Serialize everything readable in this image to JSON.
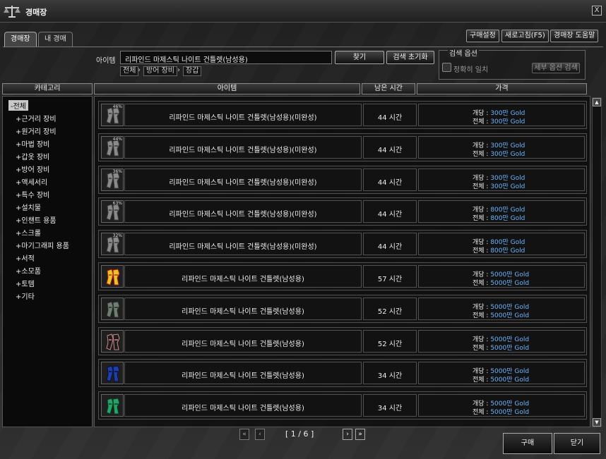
{
  "window": {
    "title": "경매장",
    "close_label": "X"
  },
  "tabs": [
    {
      "label": "경매장"
    },
    {
      "label": "내 경매"
    }
  ],
  "top_buttons": {
    "purchase_settings": "구매설정",
    "refresh": "새로고침(F5)",
    "help": "경매장 도움말"
  },
  "search": {
    "item_label": "아이템",
    "query": "리파인드 마제스틱 나이트 건틀렛(남성용)",
    "find_label": "찾기",
    "reset_label": "검색 초기화",
    "breadcrumb": [
      "전체",
      "방어 장비",
      "장갑"
    ]
  },
  "options": {
    "title": "검색 옵션",
    "exact_match": "정확히 일치",
    "exact_checked": false,
    "detail_label": "세부 옵션 검색"
  },
  "headers": {
    "category": "카테고리",
    "item": "아이템",
    "time_left": "남은 시간",
    "price": "가격"
  },
  "categories": [
    {
      "label": "-전체",
      "selected": true
    },
    {
      "label": "+근거리 장비"
    },
    {
      "label": "+원거리 장비"
    },
    {
      "label": "+마법 장비"
    },
    {
      "label": "+갑옷 장비"
    },
    {
      "label": "+방어 장비"
    },
    {
      "label": "+액세서리"
    },
    {
      "label": "+특수 장비"
    },
    {
      "label": "+설치물"
    },
    {
      "label": "+인챈트 용품"
    },
    {
      "label": "+스크롤"
    },
    {
      "label": "+마기그래피 용품"
    },
    {
      "label": "+서적"
    },
    {
      "label": "+소모품"
    },
    {
      "label": "+토템"
    },
    {
      "label": "+기타"
    }
  ],
  "items": [
    {
      "pct": "46%",
      "name": "리파인드 마제스틱 나이트 건틀렛(남성용)(미완성)",
      "time": "44 시간",
      "unit_label": "개당 : ",
      "unit_price": "300만 Gold",
      "total_label": "전체 : ",
      "total_price": "300만 Gold",
      "color": "#8a8a8a",
      "accent": "#3a3a3a"
    },
    {
      "pct": "44%",
      "name": "리파인드 마제스틱 나이트 건틀렛(남성용)(미완성)",
      "time": "44 시간",
      "unit_label": "개당 : ",
      "unit_price": "300만 Gold",
      "total_label": "전체 : ",
      "total_price": "300만 Gold",
      "color": "#8a8a8a",
      "accent": "#3a3a3a"
    },
    {
      "pct": "36%",
      "name": "리파인드 마제스틱 나이트 건틀렛(남성용)(미완성)",
      "time": "44 시간",
      "unit_label": "개당 : ",
      "unit_price": "300만 Gold",
      "total_label": "전체 : ",
      "total_price": "300만 Gold",
      "color": "#8a8a8a",
      "accent": "#3a3a3a"
    },
    {
      "pct": "63%",
      "name": "리파인드 마제스틱 나이트 건틀렛(남성용)(미완성)",
      "time": "44 시간",
      "unit_label": "개당 : ",
      "unit_price": "800만 Gold",
      "total_label": "전체 : ",
      "total_price": "800만 Gold",
      "color": "#8a8a8a",
      "accent": "#3a3a3a"
    },
    {
      "pct": "32%",
      "name": "리파인드 마제스틱 나이트 건틀렛(남성용)(미완성)",
      "time": "44 시간",
      "unit_label": "개당 : ",
      "unit_price": "800만 Gold",
      "total_label": "전체 : ",
      "total_price": "800만 Gold",
      "color": "#8a8a8a",
      "accent": "#3a3a3a"
    },
    {
      "pct": "",
      "name": "리파인드 마제스틱 나이트 건틀렛(남성용)",
      "time": "57 시간",
      "unit_label": "개당 : ",
      "unit_price": "5000만 Gold",
      "total_label": "전체 : ",
      "total_price": "5000만 Gold",
      "color": "#e6c620",
      "accent": "#c0201a"
    },
    {
      "pct": "",
      "name": "리파인드 마제스틱 나이트 건틀렛(남성용)",
      "time": "52 시간",
      "unit_label": "개당 : ",
      "unit_price": "5000만 Gold",
      "total_label": "전체 : ",
      "total_price": "5000만 Gold",
      "color": "#6f7f6f",
      "accent": "#2a2a2a"
    },
    {
      "pct": "",
      "name": "리파인드 마제스틱 나이트 건틀렛(남성용)",
      "time": "52 시간",
      "unit_label": "개당 : ",
      "unit_price": "5000만 Gold",
      "total_label": "전체 : ",
      "total_price": "5000만 Gold",
      "color": "#1a1a1a",
      "accent": "#d08a8a"
    },
    {
      "pct": "",
      "name": "리파인드 마제스틱 나이트 건틀렛(남성용)",
      "time": "34 시간",
      "unit_label": "개당 : ",
      "unit_price": "5000만 Gold",
      "total_label": "전체 : ",
      "total_price": "5000만 Gold",
      "color": "#1d3faa",
      "accent": "#0c0c30"
    },
    {
      "pct": "",
      "name": "리파인드 마제스틱 나이트 건틀렛(남성용)",
      "time": "34 시간",
      "unit_label": "개당 : ",
      "unit_price": "5000만 Gold",
      "total_label": "전체 : ",
      "total_price": "5000만 Gold",
      "color": "#25a46a",
      "accent": "#0d3a22"
    }
  ],
  "pager": {
    "text": "[ 1 / 6 ]",
    "first": "«",
    "prev": "‹",
    "next": "›",
    "last": "»"
  },
  "bottom": {
    "buy_label": "구매",
    "close_label": "닫기"
  },
  "scrollbar": {
    "up": "▲",
    "down": "▼"
  }
}
